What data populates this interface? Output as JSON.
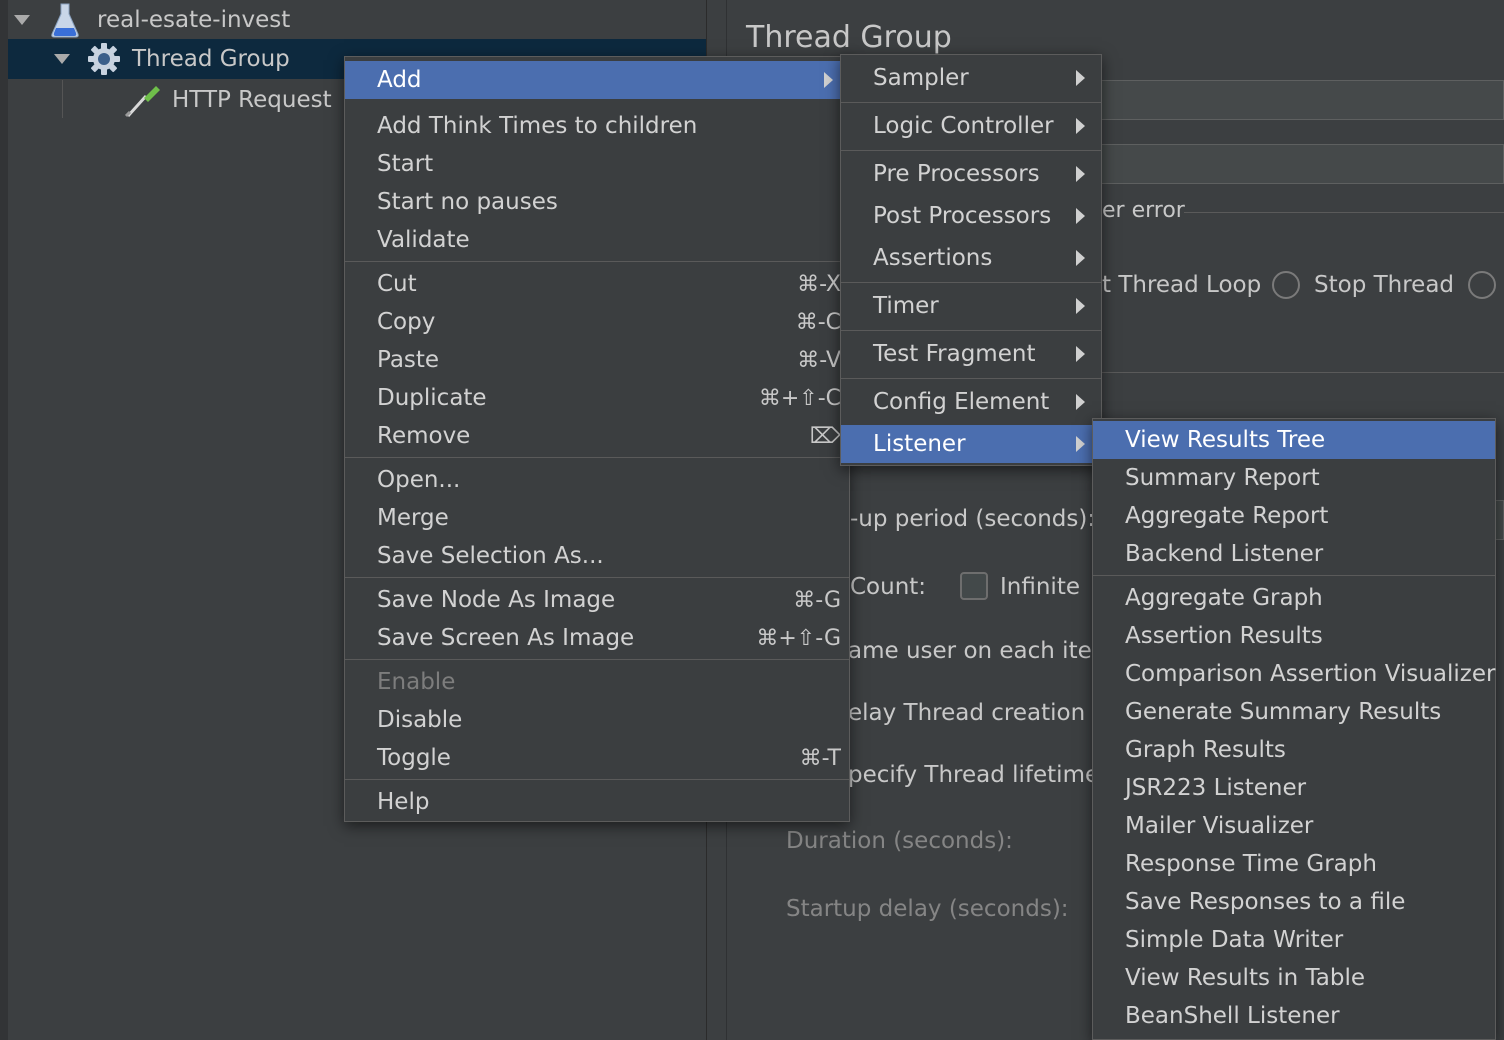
{
  "tree": {
    "plan_label": "real-esate-invest",
    "thread_group_label": "Thread Group",
    "http_request_label": "HTTP Request"
  },
  "editor": {
    "title": "Thread Group",
    "error_fragment": "er error",
    "thread_loop_fragment": "t Thread Loop",
    "stop_thread": "Stop Thread",
    "ramp_fragment": "-up period (seconds):",
    "count_fragment": "Count:",
    "infinite": "Infinite",
    "same_user_fragment": "ame user on each itera",
    "delay_fragment": "elay Thread creation u",
    "lifetime_fragment": "pecify Thread lifetime",
    "duration": "Duration (seconds):",
    "startup_delay": "Startup delay (seconds):"
  },
  "context_menu": {
    "items": [
      {
        "label": "Add",
        "shortcut": ""
      },
      {
        "label": "Add Think Times to children",
        "shortcut": ""
      },
      {
        "label": "Start",
        "shortcut": ""
      },
      {
        "label": "Start no pauses",
        "shortcut": ""
      },
      {
        "label": "Validate",
        "shortcut": ""
      },
      {
        "label": "Cut",
        "shortcut": "⌘-X"
      },
      {
        "label": "Copy",
        "shortcut": "⌘-C"
      },
      {
        "label": "Paste",
        "shortcut": "⌘-V"
      },
      {
        "label": "Duplicate",
        "shortcut": "⌘+⇧-C"
      },
      {
        "label": "Remove",
        "shortcut": "⌦"
      },
      {
        "label": "Open...",
        "shortcut": ""
      },
      {
        "label": "Merge",
        "shortcut": ""
      },
      {
        "label": "Save Selection As...",
        "shortcut": ""
      },
      {
        "label": "Save Node As Image",
        "shortcut": "⌘-G"
      },
      {
        "label": "Save Screen As Image",
        "shortcut": "⌘+⇧-G"
      },
      {
        "label": "Enable",
        "shortcut": ""
      },
      {
        "label": "Disable",
        "shortcut": ""
      },
      {
        "label": "Toggle",
        "shortcut": "⌘-T"
      },
      {
        "label": "Help",
        "shortcut": ""
      }
    ]
  },
  "add_submenu": {
    "items": [
      {
        "label": "Sampler"
      },
      {
        "label": "Logic Controller"
      },
      {
        "label": "Pre Processors"
      },
      {
        "label": "Post Processors"
      },
      {
        "label": "Assertions"
      },
      {
        "label": "Timer"
      },
      {
        "label": "Test Fragment"
      },
      {
        "label": "Config Element"
      },
      {
        "label": "Listener"
      }
    ]
  },
  "listener_submenu": {
    "items": [
      {
        "label": "View Results Tree"
      },
      {
        "label": "Summary Report"
      },
      {
        "label": "Aggregate Report"
      },
      {
        "label": "Backend Listener"
      },
      {
        "label": "Aggregate Graph"
      },
      {
        "label": "Assertion Results"
      },
      {
        "label": "Comparison Assertion Visualizer"
      },
      {
        "label": "Generate Summary Results"
      },
      {
        "label": "Graph Results"
      },
      {
        "label": "JSR223 Listener"
      },
      {
        "label": "Mailer Visualizer"
      },
      {
        "label": "Response Time Graph"
      },
      {
        "label": "Save Responses to a file"
      },
      {
        "label": "Simple Data Writer"
      },
      {
        "label": "View Results in Table"
      },
      {
        "label": "BeanShell Listener"
      }
    ]
  },
  "colors": {
    "selection": "#4b6eaf",
    "tree_selection": "#0d293e",
    "background": "#3c3f41"
  }
}
